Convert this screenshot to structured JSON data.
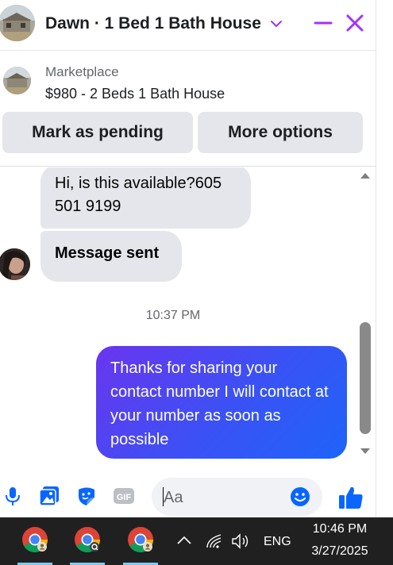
{
  "header": {
    "title": "Dawn · 1 Bed 1 Bath House",
    "accent_color": "#a033ff"
  },
  "listing": {
    "kicker": "Marketplace",
    "title": "$980 - 2 Beds 1 Bath House",
    "buttons": {
      "pending": "Mark as pending",
      "more": "More options"
    }
  },
  "messages": {
    "incoming": [
      {
        "text": "Hi, is this available?605 501 9199"
      },
      {
        "text": "Message sent"
      }
    ],
    "timestamp": "10:37 PM",
    "outgoing": [
      {
        "text": "Thanks for sharing your contact number I will contact at your number as soon as possible"
      }
    ]
  },
  "composer": {
    "placeholder": "Aa",
    "icons": [
      "microphone-icon",
      "photo-icon",
      "sticker-icon",
      "gif-icon",
      "emoji-icon",
      "thumbs-up-icon"
    ],
    "gif_label": "GIF",
    "icon_color": "#0866ff"
  },
  "taskbar": {
    "apps": [
      "chrome-icon",
      "chrome-icon",
      "chrome-icon"
    ],
    "language": "ENG",
    "time": "10:46 PM",
    "date": "3/27/2025"
  }
}
